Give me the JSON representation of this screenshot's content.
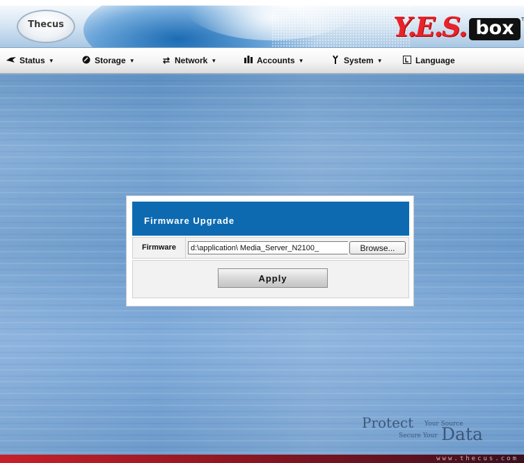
{
  "header": {
    "logo_text": "Thecus",
    "brand_yes": "Y.E.S.",
    "brand_box": "box",
    "brand_tm": "TM"
  },
  "menu": [
    {
      "label": "Status",
      "icon": "status-icon"
    },
    {
      "label": "Storage",
      "icon": "storage-icon"
    },
    {
      "label": "Network",
      "icon": "network-icon"
    },
    {
      "label": "Accounts",
      "icon": "accounts-icon"
    },
    {
      "label": "System",
      "icon": "system-icon"
    },
    {
      "label": "Language",
      "icon": "language-icon"
    }
  ],
  "dialog": {
    "title": "Firmware Upgrade",
    "field_label": "Firmware",
    "field_value": "d:\\application\\ Media_Server_N2100_",
    "browse_label": "Browse...",
    "apply_label": "Apply"
  },
  "slogan": {
    "protect": "Protect",
    "your_source": "Your Source",
    "secure_your": "Secure Your",
    "data": "Data"
  },
  "footer": {
    "url": "www.thecus.com"
  },
  "colors": {
    "dialog_title_bg": "#0d6ab1",
    "brand_red": "#e8232a",
    "footer_red": "#c8202a"
  }
}
